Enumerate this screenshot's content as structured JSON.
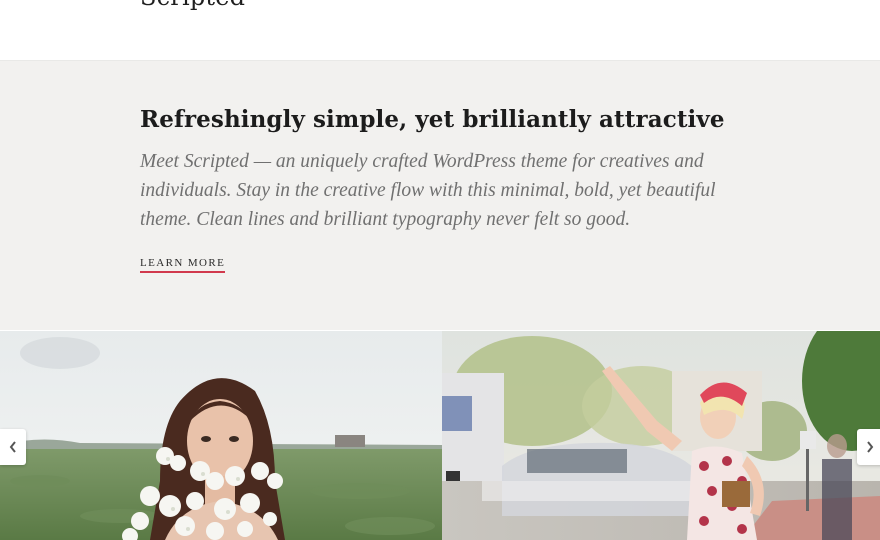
{
  "header": {
    "logo": "Scripted",
    "menu_icon": "hamburger-menu-icon"
  },
  "hero": {
    "title": "Refreshingly simple, yet brilliantly attractive",
    "description": "Meet Scripted — an uniquely crafted WordPress theme for creatives and individuals. Stay in the creative flow with this minimal, bold, yet beautiful theme. Clean lines and brilliant typography never felt so good.",
    "cta_label": "LEARN MORE",
    "background_color": "#f2f1ef",
    "accent_color": "#d1394d"
  },
  "gallery": {
    "photos": [
      {
        "subject": "woman holding white flowers in a field"
      },
      {
        "subject": "woman in red hat hailing a car on a street"
      }
    ],
    "prev_icon": "chevron-left-icon",
    "next_icon": "chevron-right-icon"
  }
}
